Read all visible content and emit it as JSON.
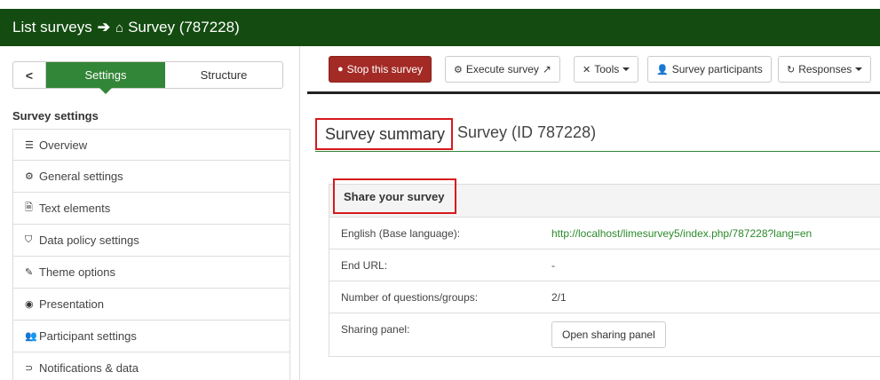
{
  "header": {
    "list_label": "List surveys",
    "arrow": "➔",
    "home_icon": "⌂",
    "survey_label": "Survey (787228)"
  },
  "sidebar": {
    "tabs": {
      "back": "<",
      "settings": "Settings",
      "structure": "Structure"
    },
    "section_title": "Survey settings",
    "items": [
      {
        "icon": "☰",
        "label": "Overview"
      },
      {
        "icon": "⚙",
        "label": "General settings"
      },
      {
        "icon": "🗎",
        "label": "Text elements"
      },
      {
        "icon": "⛉",
        "label": "Data policy settings"
      },
      {
        "icon": "✎",
        "label": "Theme options"
      },
      {
        "icon": "◉",
        "label": "Presentation"
      },
      {
        "icon": "👥",
        "label": "Participant settings"
      },
      {
        "icon": "⊃",
        "label": "Notifications & data"
      }
    ]
  },
  "toolbar": {
    "stop": {
      "icon": "●",
      "label": "Stop this survey"
    },
    "execute": {
      "icon": "⚙",
      "label": "Execute survey",
      "suffix": "↗"
    },
    "tools": {
      "icon": "✕",
      "label": "Tools"
    },
    "participants": {
      "icon": "👤",
      "label": "Survey participants"
    },
    "responses": {
      "icon": "↻",
      "label": "Responses"
    }
  },
  "summary": {
    "title": "Survey summary",
    "subtitle": "Survey (ID 787228)"
  },
  "share": {
    "title": "Share your survey",
    "rows": [
      {
        "label": "English (Base language):",
        "value": "http://localhost/limesurvey5/index.php/787228?lang=en"
      },
      {
        "label": "End URL:",
        "value": "-"
      },
      {
        "label": "Number of questions/groups:",
        "value": "2/1"
      },
      {
        "label": "Sharing panel:",
        "button": "Open sharing panel"
      }
    ]
  },
  "colors": {
    "header_bg": "#134b10",
    "active_tab": "#328637",
    "stop_button": "#a32a25",
    "highlight_border": "#d7191c",
    "link": "#2c8a2c"
  }
}
